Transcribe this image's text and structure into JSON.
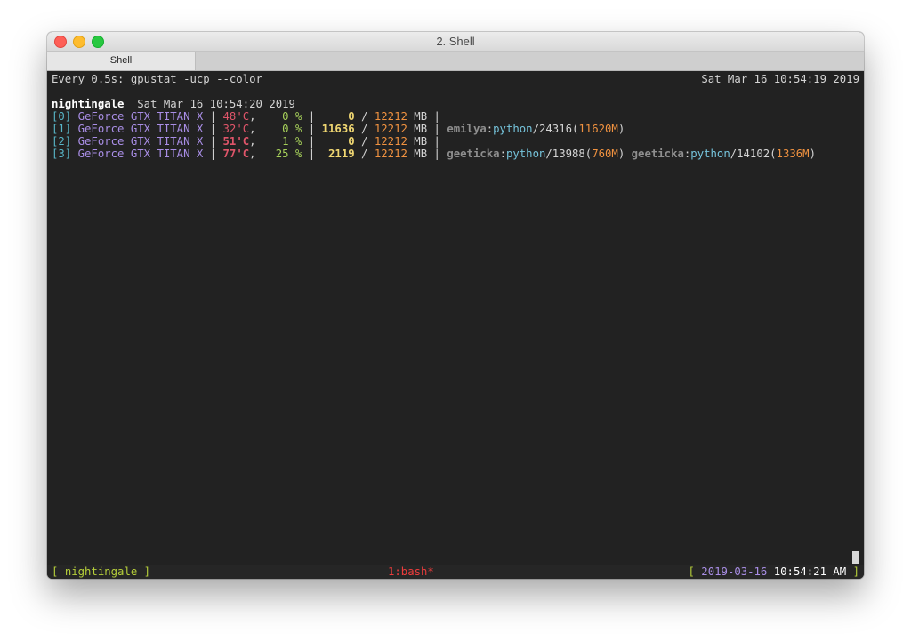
{
  "window": {
    "title": "2. Shell",
    "tab_label": "Shell"
  },
  "header": {
    "command": "Every 0.5s: gpustat -ucp --color",
    "timestamp": "Sat Mar 16 10:54:19 2019"
  },
  "host": {
    "name": "nightingale",
    "timestamp": "Sat Mar 16 10:54:20 2019"
  },
  "gpus": [
    {
      "index": "[0]",
      "name": "GeForce GTX TITAN X",
      "temp": "48'C",
      "util": "0",
      "mem_used": "0",
      "mem_total": "12212",
      "mem_unit": "MB",
      "processes": []
    },
    {
      "index": "[1]",
      "name": "GeForce GTX TITAN X",
      "temp": "32'C",
      "util": "0",
      "mem_used": "11636",
      "mem_total": "12212",
      "mem_unit": "MB",
      "processes": [
        {
          "user": "emilya",
          "cmd": "python",
          "pid": "24316",
          "mem": "11620M"
        }
      ]
    },
    {
      "index": "[2]",
      "name": "GeForce GTX TITAN X",
      "temp": "51'C",
      "util": "1",
      "mem_used": "0",
      "mem_total": "12212",
      "mem_unit": "MB",
      "processes": []
    },
    {
      "index": "[3]",
      "name": "GeForce GTX TITAN X",
      "temp": "77'C",
      "util": "25",
      "mem_used": "2119",
      "mem_total": "12212",
      "mem_unit": "MB",
      "processes": [
        {
          "user": "geeticka",
          "cmd": "python",
          "pid": "13988",
          "mem": "760M"
        },
        {
          "user": "geeticka",
          "cmd": "python",
          "pid": "14102",
          "mem": "1336M"
        }
      ]
    }
  ],
  "statusbar": {
    "session": "nightingale",
    "window": "1:bash*",
    "date": "2019-03-16",
    "time": "10:54:21 AM"
  }
}
